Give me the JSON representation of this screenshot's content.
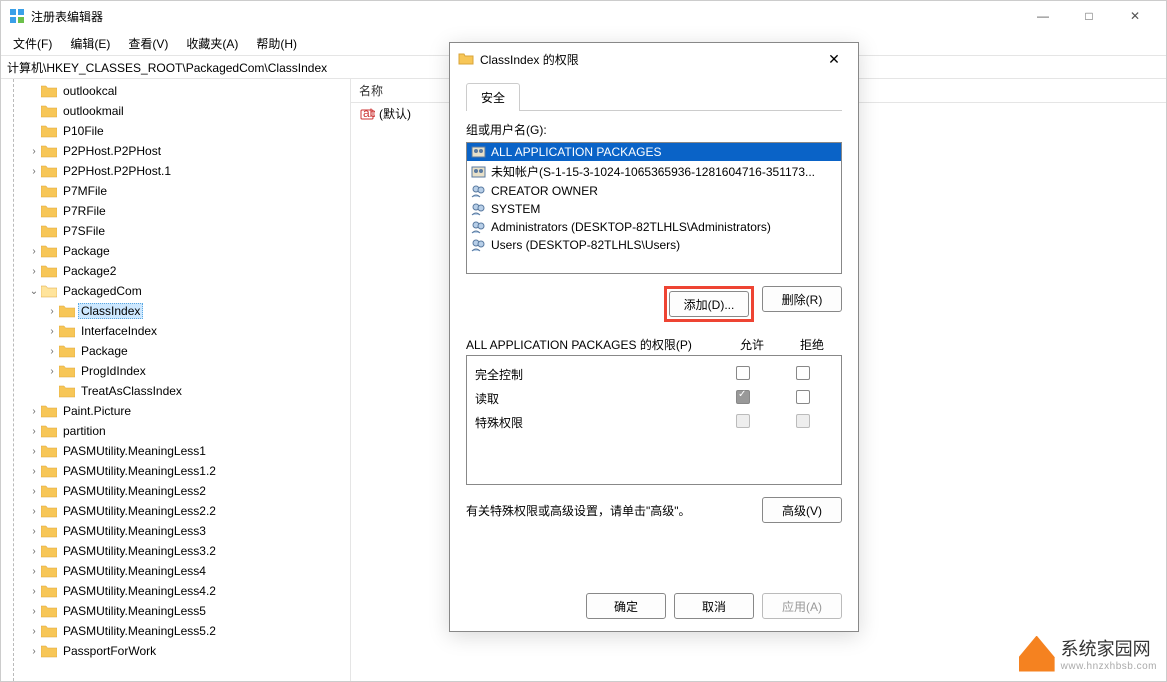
{
  "window": {
    "title": "注册表编辑器",
    "minimize": "—",
    "maximize": "□",
    "close": "✕"
  },
  "menu": {
    "file": "文件(F)",
    "edit": "编辑(E)",
    "view": "查看(V)",
    "favorites": "收藏夹(A)",
    "help": "帮助(H)"
  },
  "address": "计算机\\HKEY_CLASSES_ROOT\\PackagedCom\\ClassIndex",
  "list": {
    "header_name": "名称",
    "default_value": "(默认)"
  },
  "tree": [
    {
      "indent": 1,
      "chev": "",
      "label": "outlookcal"
    },
    {
      "indent": 1,
      "chev": "",
      "label": "outlookmail"
    },
    {
      "indent": 1,
      "chev": "",
      "label": "P10File"
    },
    {
      "indent": 1,
      "chev": ">",
      "label": "P2PHost.P2PHost"
    },
    {
      "indent": 1,
      "chev": ">",
      "label": "P2PHost.P2PHost.1"
    },
    {
      "indent": 1,
      "chev": "",
      "label": "P7MFile"
    },
    {
      "indent": 1,
      "chev": "",
      "label": "P7RFile"
    },
    {
      "indent": 1,
      "chev": "",
      "label": "P7SFile"
    },
    {
      "indent": 1,
      "chev": ">",
      "label": "Package"
    },
    {
      "indent": 1,
      "chev": ">",
      "label": "Package2"
    },
    {
      "indent": 1,
      "chev": "v",
      "label": "PackagedCom",
      "open": true
    },
    {
      "indent": 2,
      "chev": ">",
      "label": "ClassIndex",
      "selected": true
    },
    {
      "indent": 2,
      "chev": ">",
      "label": "InterfaceIndex"
    },
    {
      "indent": 2,
      "chev": ">",
      "label": "Package"
    },
    {
      "indent": 2,
      "chev": ">",
      "label": "ProgIdIndex"
    },
    {
      "indent": 2,
      "chev": "",
      "label": "TreatAsClassIndex"
    },
    {
      "indent": 1,
      "chev": ">",
      "label": "Paint.Picture"
    },
    {
      "indent": 1,
      "chev": ">",
      "label": "partition"
    },
    {
      "indent": 1,
      "chev": ">",
      "label": "PASMUtility.MeaningLess1"
    },
    {
      "indent": 1,
      "chev": ">",
      "label": "PASMUtility.MeaningLess1.2"
    },
    {
      "indent": 1,
      "chev": ">",
      "label": "PASMUtility.MeaningLess2"
    },
    {
      "indent": 1,
      "chev": ">",
      "label": "PASMUtility.MeaningLess2.2"
    },
    {
      "indent": 1,
      "chev": ">",
      "label": "PASMUtility.MeaningLess3"
    },
    {
      "indent": 1,
      "chev": ">",
      "label": "PASMUtility.MeaningLess3.2"
    },
    {
      "indent": 1,
      "chev": ">",
      "label": "PASMUtility.MeaningLess4"
    },
    {
      "indent": 1,
      "chev": ">",
      "label": "PASMUtility.MeaningLess4.2"
    },
    {
      "indent": 1,
      "chev": ">",
      "label": "PASMUtility.MeaningLess5"
    },
    {
      "indent": 1,
      "chev": ">",
      "label": "PASMUtility.MeaningLess5.2"
    },
    {
      "indent": 1,
      "chev": ">",
      "label": "PassportForWork"
    }
  ],
  "dialog": {
    "title": "ClassIndex 的权限",
    "tab_security": "安全",
    "group_label": "组或用户名(G):",
    "users": [
      {
        "label": "ALL APPLICATION PACKAGES",
        "sel": true,
        "icon": "group"
      },
      {
        "label": "未知帐户(S-1-15-3-1024-1065365936-1281604716-351173...",
        "icon": "group"
      },
      {
        "label": "CREATOR OWNER",
        "icon": "users"
      },
      {
        "label": "SYSTEM",
        "icon": "users"
      },
      {
        "label": "Administrators (DESKTOP-82TLHLS\\Administrators)",
        "icon": "users"
      },
      {
        "label": "Users (DESKTOP-82TLHLS\\Users)",
        "icon": "users"
      }
    ],
    "btn_add": "添加(D)...",
    "btn_remove": "删除(R)",
    "perms_label": "ALL APPLICATION PACKAGES 的权限(P)",
    "col_allow": "允许",
    "col_deny": "拒绝",
    "perms": [
      {
        "name": "完全控制",
        "allow": "",
        "deny": ""
      },
      {
        "name": "读取",
        "allow": "checked",
        "deny": ""
      },
      {
        "name": "特殊权限",
        "allow": "semi",
        "deny": "semi"
      }
    ],
    "hint": "有关特殊权限或高级设置，请单击\"高级\"。",
    "btn_adv": "高级(V)",
    "btn_ok": "确定",
    "btn_cancel": "取消",
    "btn_apply": "应用(A)"
  },
  "watermark": {
    "text": "系统家园网",
    "url": "www.hnzxhbsb.com"
  }
}
